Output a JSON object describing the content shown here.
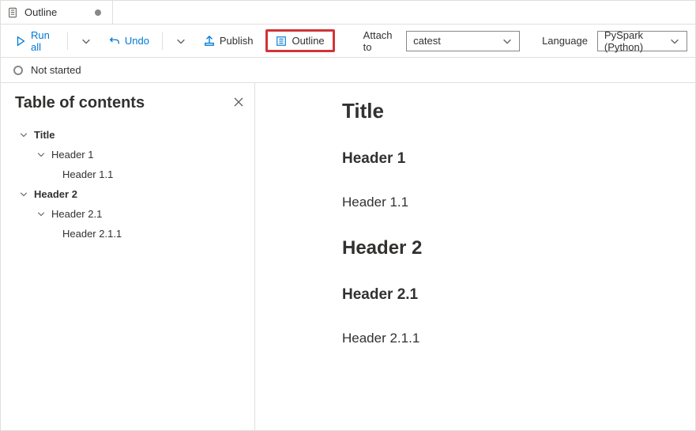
{
  "tab": {
    "label": "Outline"
  },
  "toolbar": {
    "run_all": "Run all",
    "undo": "Undo",
    "publish": "Publish",
    "outline": "Outline",
    "attach_to_label": "Attach to",
    "attach_to_value": "catest",
    "language_label": "Language",
    "language_value": "PySpark (Python)"
  },
  "status": {
    "text": "Not started"
  },
  "toc": {
    "title": "Table of contents",
    "items": [
      {
        "label": "Title"
      },
      {
        "label": "Header 1"
      },
      {
        "label": "Header 1.1"
      },
      {
        "label": "Header 2"
      },
      {
        "label": "Header 2.1"
      },
      {
        "label": "Header 2.1.1"
      }
    ]
  },
  "doc": {
    "title": "Title",
    "h1": "Header 1",
    "h11": "Header 1.1",
    "h2": "Header 2",
    "h21": "Header 2.1",
    "h211": "Header 2.1.1"
  }
}
